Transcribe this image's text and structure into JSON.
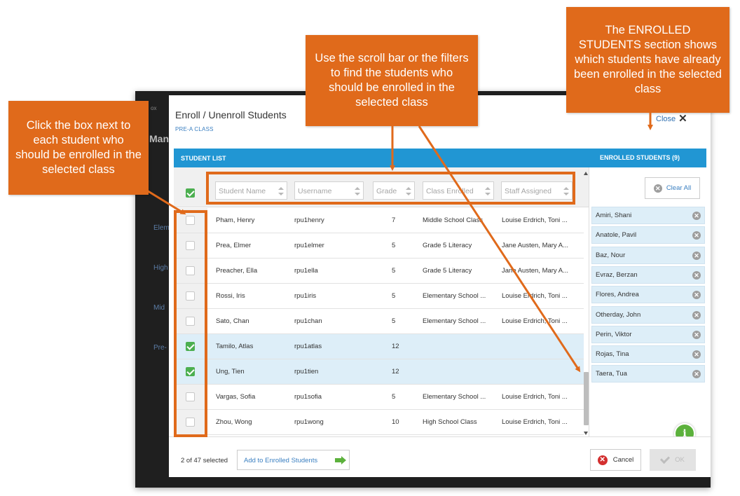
{
  "backdrop": {
    "title_fragment": "Man",
    "small_fragment": "ox",
    "side_items": [
      "Elem",
      "High",
      "Mid",
      "Pre-"
    ]
  },
  "dialog": {
    "title": "Enroll / Unenroll Students",
    "subtitle": "PRE-A CLASS",
    "close_label": "Close"
  },
  "student_list": {
    "header": "STUDENT LIST",
    "filters": [
      {
        "placeholder": "Student Name"
      },
      {
        "placeholder": "Username"
      },
      {
        "placeholder": "Grade"
      },
      {
        "placeholder": "Class Enrolled"
      },
      {
        "placeholder": "Staff Assigned"
      }
    ],
    "header_checked": true,
    "rows": [
      {
        "name": "Pham, Henry",
        "username": "rpu1henry",
        "grade": "7",
        "class": "Middle School Class",
        "staff": "Louise Erdrich, Toni ...",
        "checked": false
      },
      {
        "name": "Prea, Elmer",
        "username": "rpu1elmer",
        "grade": "5",
        "class": "Grade 5 Literacy",
        "staff": "Jane Austen, Mary A...",
        "checked": false
      },
      {
        "name": "Preacher, Ella",
        "username": "rpu1ella",
        "grade": "5",
        "class": "Grade 5 Literacy",
        "staff": "Jane Austen, Mary A...",
        "checked": false
      },
      {
        "name": "Rossi, Iris",
        "username": "rpu1iris",
        "grade": "5",
        "class": "Elementary School ...",
        "staff": "Louise Erdrich, Toni ...",
        "checked": false
      },
      {
        "name": "Sato, Chan",
        "username": "rpu1chan",
        "grade": "5",
        "class": "Elementary School ...",
        "staff": "Louise Erdrich, Toni ...",
        "checked": false
      },
      {
        "name": "Tamilo, Atlas",
        "username": "rpu1atlas",
        "grade": "12",
        "class": "",
        "staff": "",
        "checked": true
      },
      {
        "name": "Ung, Tien",
        "username": "rpu1tien",
        "grade": "12",
        "class": "",
        "staff": "",
        "checked": true
      },
      {
        "name": "Vargas, Sofia",
        "username": "rpu1sofia",
        "grade": "5",
        "class": "Elementary School ...",
        "staff": "Louise Erdrich, Toni ...",
        "checked": false
      },
      {
        "name": "Zhou, Wong",
        "username": "rpu1wong",
        "grade": "10",
        "class": "High School Class",
        "staff": "Louise Erdrich, Toni ...",
        "checked": false
      }
    ]
  },
  "enrolled": {
    "header": "ENROLLED STUDENTS (9)",
    "clear_all_label": "Clear All",
    "students": [
      "Amiri, Shani",
      "Anatole, Pavil",
      "Baz, Nour",
      "Evraz, Berzan",
      "Flores, Andrea",
      "Otherday, John",
      "Perin, Viktor",
      "Rojas, Tina",
      "Taera, Tua"
    ]
  },
  "footer": {
    "selected_count": "2 of 47 selected",
    "add_label": "Add to Enrolled Students",
    "cancel_label": "Cancel",
    "ok_label": "OK"
  },
  "info_button_label": "i",
  "callouts": {
    "checkbox_tip": "Click the box next to each student who should be enrolled in the selected class",
    "filter_tip": "Use the scroll bar or the filters to find the students who should be enrolled in the selected class",
    "enrolled_tip": "The ENROLLED STUDENTS section shows which students have already been enrolled in the selected class"
  },
  "colors": {
    "accent_blue": "#2196d3",
    "callout_orange": "#e06a1b",
    "check_green": "#4caf50",
    "selected_row": "#ddeef8"
  }
}
